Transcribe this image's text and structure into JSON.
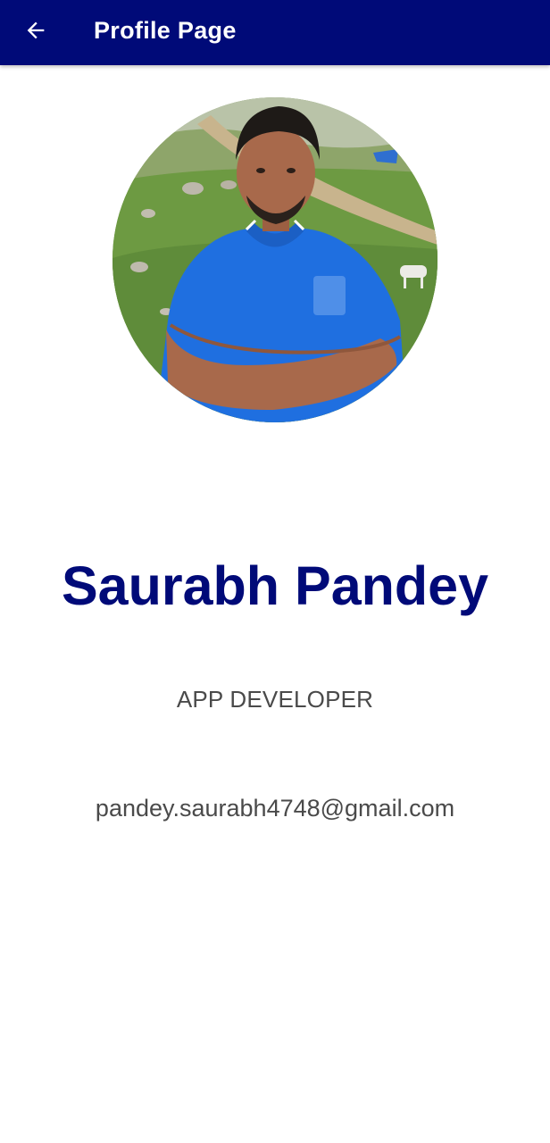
{
  "appbar": {
    "title": "Profile Page",
    "back_icon": "arrow-left-icon",
    "background_color": "#000a78"
  },
  "profile": {
    "avatar": "profile-photo",
    "name": "Saurabh Pandey",
    "role": "APP DEVELOPER",
    "email": "pandey.saurabh4748@gmail.com",
    "name_color": "#000a78"
  }
}
